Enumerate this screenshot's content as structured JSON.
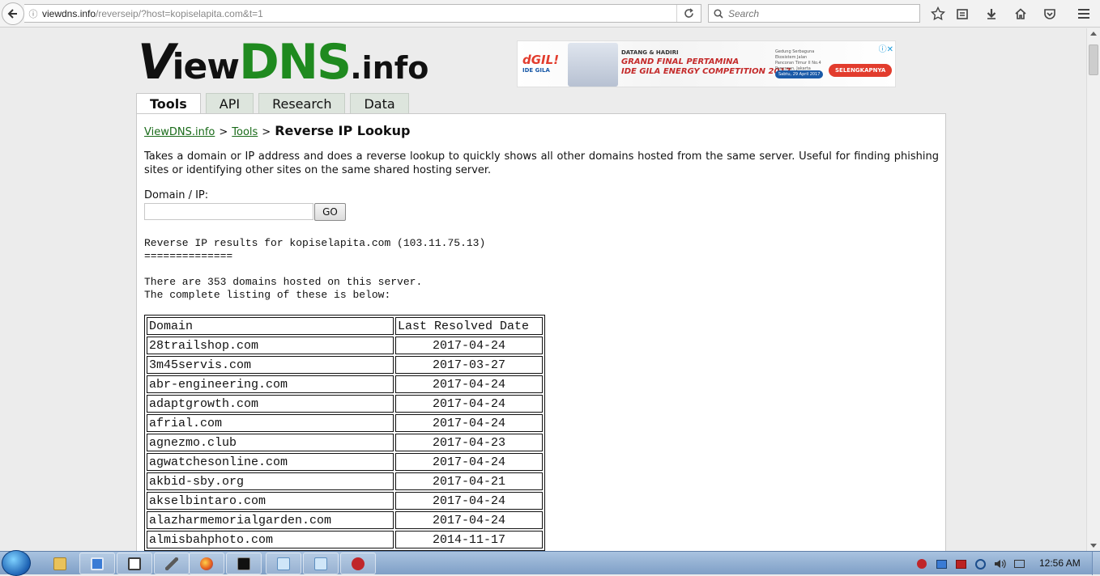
{
  "browser": {
    "url_host": "viewdns.info",
    "url_path": "/reverseip/?host=kopiselapita.com&t=1",
    "search_placeholder": "Search"
  },
  "logo": {
    "part1": "V",
    "part2": "iew",
    "part3": "DNS",
    "part4": ".info"
  },
  "ad": {
    "brand": "dGIL!",
    "brand_sub": "IDE GILA",
    "line1": "DATANG & HADIRI",
    "line2": "GRAND FINAL PERTAMINA",
    "line3": "IDE GILA ENERGY COMPETITION 2017",
    "venue": "Gedung Serbaguna Ekosistem Jalan Pancoran Timur II No.4 Pancoran, Jakarta Selatan",
    "date": "Sabtu, 29 April 2017",
    "cta": "SELENGKAPNYA"
  },
  "tabs": [
    {
      "label": "Tools",
      "active": true
    },
    {
      "label": "API",
      "active": false
    },
    {
      "label": "Research",
      "active": false
    },
    {
      "label": "Data",
      "active": false
    }
  ],
  "breadcrumb": {
    "home": "ViewDNS.info",
    "sep1": ">",
    "tools": "Tools",
    "sep2": ">",
    "current": "Reverse IP Lookup"
  },
  "description": "Takes a domain or IP address and does a reverse lookup to quickly shows all other domains hosted from the same server. Useful for finding phishing sites or identifying other sites on the same shared hosting server.",
  "form": {
    "label": "Domain / IP:",
    "value": "",
    "button": "GO"
  },
  "results": {
    "header_line": "Reverse IP results for kopiselapita.com (103.11.75.13)",
    "underline": "==============",
    "count_line": "There are 353 domains hosted on this server.",
    "listing_line": "The complete listing of these is below:",
    "columns": [
      "Domain",
      "Last Resolved Date"
    ],
    "rows": [
      [
        "28trailshop.com",
        "2017-04-24"
      ],
      [
        "3m45servis.com",
        "2017-03-27"
      ],
      [
        "abr-engineering.com",
        "2017-04-24"
      ],
      [
        "adaptgrowth.com",
        "2017-04-24"
      ],
      [
        "afrial.com",
        "2017-04-24"
      ],
      [
        "agnezmo.club",
        "2017-04-23"
      ],
      [
        "agwatchesonline.com",
        "2017-04-24"
      ],
      [
        "akbid-sby.org",
        "2017-04-21"
      ],
      [
        "akselbintaro.com",
        "2017-04-24"
      ],
      [
        "alazharmemorialgarden.com",
        "2017-04-24"
      ],
      [
        "almisbahphoto.com",
        "2014-11-17"
      ]
    ]
  },
  "taskbar": {
    "clock": "12:56 AM"
  },
  "colors": {
    "brand_green": "#1f8a1f",
    "link_green": "#1a6b1a",
    "tab_bg": "#dde5dd"
  }
}
